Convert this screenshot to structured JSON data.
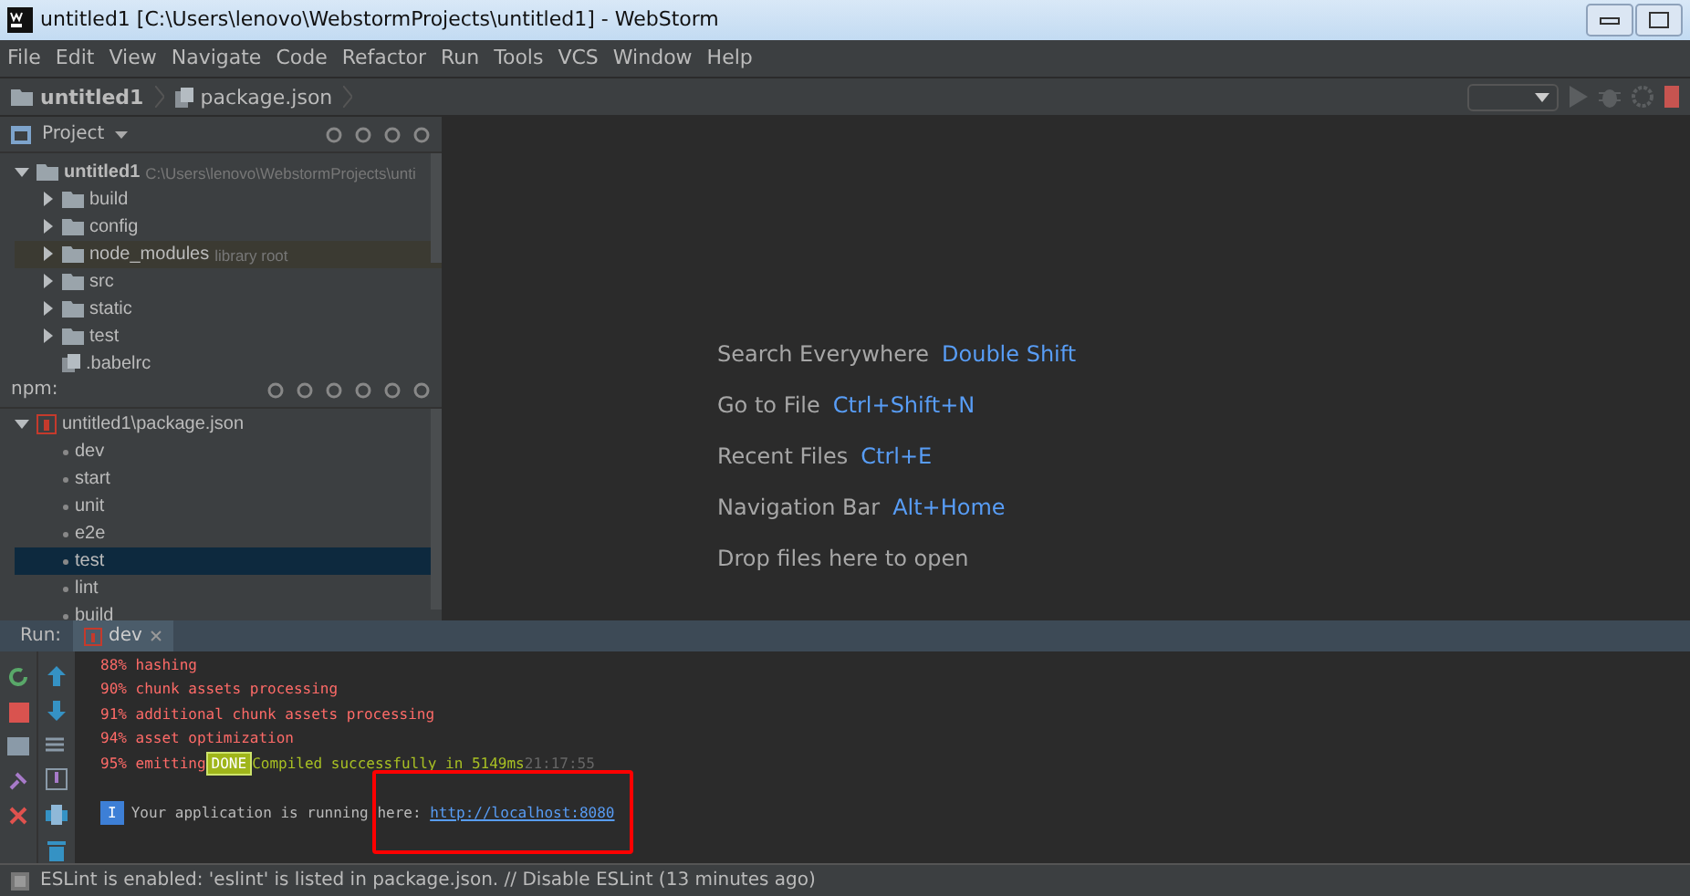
{
  "window": {
    "title": "untitled1 [C:\\Users\\lenovo\\WebstormProjects\\untitled1] - WebStorm"
  },
  "menu": [
    {
      "label": "File"
    },
    {
      "label": "Edit"
    },
    {
      "label": "View"
    },
    {
      "label": "Navigate"
    },
    {
      "label": "Code"
    },
    {
      "label": "Refactor"
    },
    {
      "label": "Run"
    },
    {
      "label": "Tools"
    },
    {
      "label": "VCS"
    },
    {
      "label": "Window"
    },
    {
      "label": "Help"
    }
  ],
  "breadcrumbs": [
    {
      "label": "untitled1",
      "kind": "folder"
    },
    {
      "label": "package.json",
      "kind": "file"
    }
  ],
  "project": {
    "title": "Project",
    "tree": [
      {
        "name": "untitled1",
        "kind": "folder",
        "note": "C:\\Users\\lenovo\\WebstormProjects\\unti",
        "expanded": true,
        "selected": false,
        "children": [
          {
            "name": "build",
            "kind": "folder",
            "expanded": false,
            "selected": false
          },
          {
            "name": "config",
            "kind": "folder",
            "expanded": false,
            "selected": false
          },
          {
            "name": "node_modules",
            "kind": "folder",
            "note": "library root",
            "expanded": false,
            "selected": true
          },
          {
            "name": "src",
            "kind": "folder",
            "expanded": false,
            "selected": false
          },
          {
            "name": "static",
            "kind": "folder",
            "expanded": false,
            "selected": false
          },
          {
            "name": "test",
            "kind": "folder",
            "expanded": false,
            "selected": false
          },
          {
            "name": ".babelrc",
            "kind": "file",
            "selected": false
          }
        ]
      }
    ]
  },
  "npm": {
    "title": "npm:",
    "package": {
      "name": "untitled1\\package.json",
      "expanded": true
    },
    "scripts": [
      {
        "name": "dev",
        "selected": false
      },
      {
        "name": "start",
        "selected": false
      },
      {
        "name": "unit",
        "selected": false
      },
      {
        "name": "e2e",
        "selected": false
      },
      {
        "name": "test",
        "selected": true
      },
      {
        "name": "lint",
        "selected": false
      },
      {
        "name": "build",
        "selected": false
      }
    ]
  },
  "welcome": [
    {
      "label": "Search Everywhere",
      "shortcut": "Double Shift"
    },
    {
      "label": "Go to File",
      "shortcut": "Ctrl+Shift+N"
    },
    {
      "label": "Recent Files",
      "shortcut": "Ctrl+E"
    },
    {
      "label": "Navigation Bar",
      "shortcut": "Alt+Home"
    },
    {
      "label": "Drop files here to open"
    }
  ],
  "run": {
    "label": "Run:",
    "tabs": [
      {
        "label": "dev",
        "selected": true
      }
    ],
    "lines": [
      {
        "kind": "progress",
        "text": "88% hashing"
      },
      {
        "kind": "progress",
        "text": "90% chunk assets processing"
      },
      {
        "kind": "progress",
        "text": "91% additional chunk assets processing"
      },
      {
        "kind": "progress",
        "text": "94% asset optimization"
      },
      {
        "kind": "done",
        "text": "95% emitting",
        "badge": "DONE",
        "message": "Compiled successfully in 5149ms",
        "time": "21:17:55"
      },
      {
        "kind": "info",
        "badge": "I",
        "text": "Your application is running here: ",
        "link": "http://localhost:8080"
      }
    ]
  },
  "status_bar": {
    "message": "ESLint is enabled: 'eslint' is listed in package.json. // Disable ESLint (13 minutes ago)"
  }
}
